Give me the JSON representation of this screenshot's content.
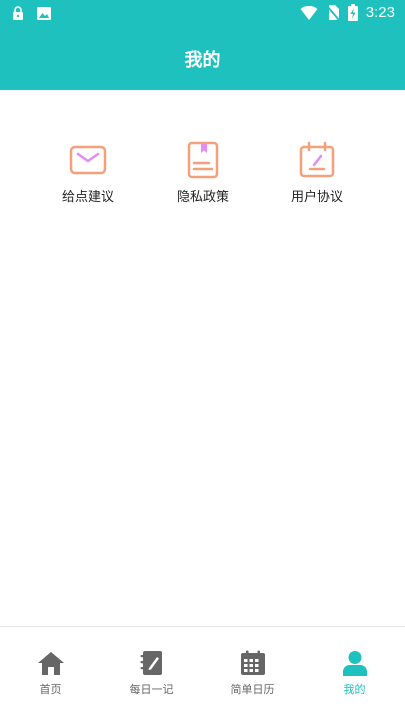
{
  "status_bar": {
    "time": "3:23",
    "icons": [
      "lock-icon",
      "image-icon",
      "wifi-icon",
      "no-sim-icon",
      "battery-charging-icon"
    ]
  },
  "header": {
    "title": "我的"
  },
  "menu": {
    "items": [
      {
        "label": "给点建议",
        "icon": "mail-icon"
      },
      {
        "label": "隐私政策",
        "icon": "bookmark-document-icon"
      },
      {
        "label": "用户协议",
        "icon": "calendar-edit-icon"
      }
    ]
  },
  "bottom_nav": {
    "items": [
      {
        "label": "首页",
        "icon": "home-icon",
        "active": false
      },
      {
        "label": "每日一记",
        "icon": "notebook-pen-icon",
        "active": false
      },
      {
        "label": "简单日历",
        "icon": "calendar-icon",
        "active": false
      },
      {
        "label": "我的",
        "icon": "user-icon",
        "active": true
      }
    ]
  },
  "colors": {
    "primary": "#1ec1bd",
    "icon_orange": "#f4a07a",
    "icon_pink": "#e48cf0",
    "nav_inactive": "#666666",
    "nav_active": "#1ec1bd"
  }
}
